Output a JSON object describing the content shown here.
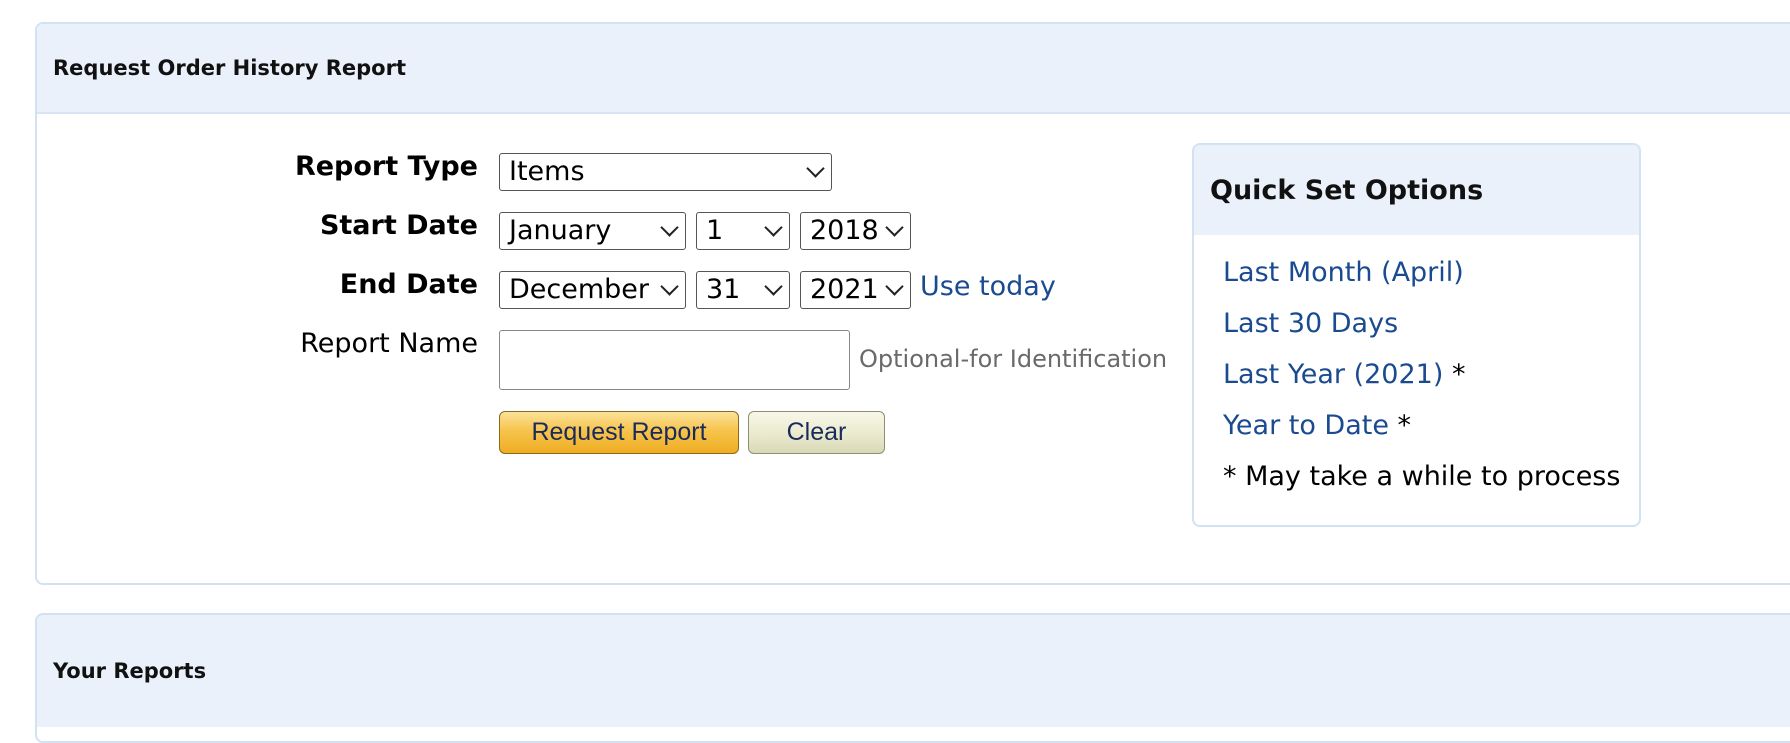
{
  "request_panel": {
    "title": "Request Order History Report",
    "report_type": {
      "label": "Report Type",
      "value": "Items"
    },
    "start_date": {
      "label": "Start Date",
      "month": "January",
      "day": "1",
      "year": "2018"
    },
    "end_date": {
      "label": "End Date",
      "month": "December",
      "day": "31",
      "year": "2021",
      "use_today": "Use today"
    },
    "report_name": {
      "label": "Report Name",
      "value": "",
      "hint": "Optional-for Identification"
    },
    "buttons": {
      "request": "Request Report",
      "clear": "Clear"
    }
  },
  "quick_set": {
    "title": "Quick Set Options",
    "items": [
      {
        "label": "Last Month (April)",
        "suffix": ""
      },
      {
        "label": "Last 30 Days",
        "suffix": ""
      },
      {
        "label": "Last Year (2021)",
        "suffix": " *"
      },
      {
        "label": "Year to Date",
        "suffix": " *"
      }
    ],
    "note": "* May take a while to process"
  },
  "reports_panel": {
    "title": "Your Reports"
  },
  "colors": {
    "header_bg": "#eaf1fb",
    "border": "#d3e2f3",
    "link": "#1a4a8f",
    "request_button": "#f6c44c",
    "clear_button": "#ebebd0"
  }
}
